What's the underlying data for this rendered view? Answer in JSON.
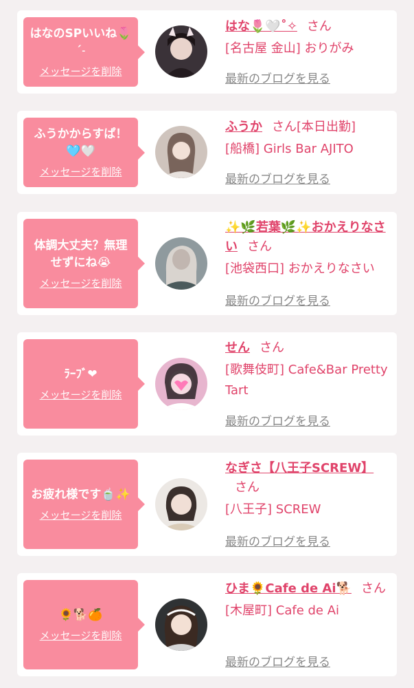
{
  "colors": {
    "accent": "#e0436a",
    "bubble": "#f98c9e",
    "background": "#f4f0f1"
  },
  "cards": [
    {
      "message": "はなのSPいいね🌷ˊ˗",
      "delete_label": "メッセージを削除",
      "name": "はな🌷🤍˚✧",
      "suffix": "さん",
      "shop": "[名古屋 金山] おりがみ",
      "blog_label": "最新のブログを見る"
    },
    {
      "message": "ふうかからすぱ！🩵🤍",
      "delete_label": "メッセージを削除",
      "name": "ふうか",
      "suffix": "さん[本日出勤]",
      "shop": "[船橋] Girls Bar AJITO",
      "blog_label": "最新のブログを見る"
    },
    {
      "message": "体調大丈夫？無理せずにね😭",
      "delete_label": "メッセージを削除",
      "name": "✨🌿若葉🌿✨おかえりなさい",
      "suffix": "さん",
      "shop": "[池袋西口] おかえりなさい",
      "blog_label": "最新のブログを見る"
    },
    {
      "message": "ﾗｰﾌﾞ❤",
      "delete_label": "メッセージを削除",
      "name": "せん",
      "suffix": "さん",
      "shop": "[歌舞伎町] Cafe&Bar Pretty Tart",
      "blog_label": "最新のブログを見る"
    },
    {
      "message": "お疲れ様です🍵✨",
      "delete_label": "メッセージを削除",
      "name": "なぎさ【八王子SCREW】",
      "suffix": "さん",
      "shop": "[八王子] SCREW",
      "blog_label": "最新のブログを見る"
    },
    {
      "message": "🌻🐕🍊",
      "delete_label": "メッセージを削除",
      "name": "ひま🌻Cafe de Ai🐕",
      "suffix": "さん",
      "shop": "[木屋町] Cafe de Ai",
      "blog_label": "最新のブログを見る"
    }
  ]
}
